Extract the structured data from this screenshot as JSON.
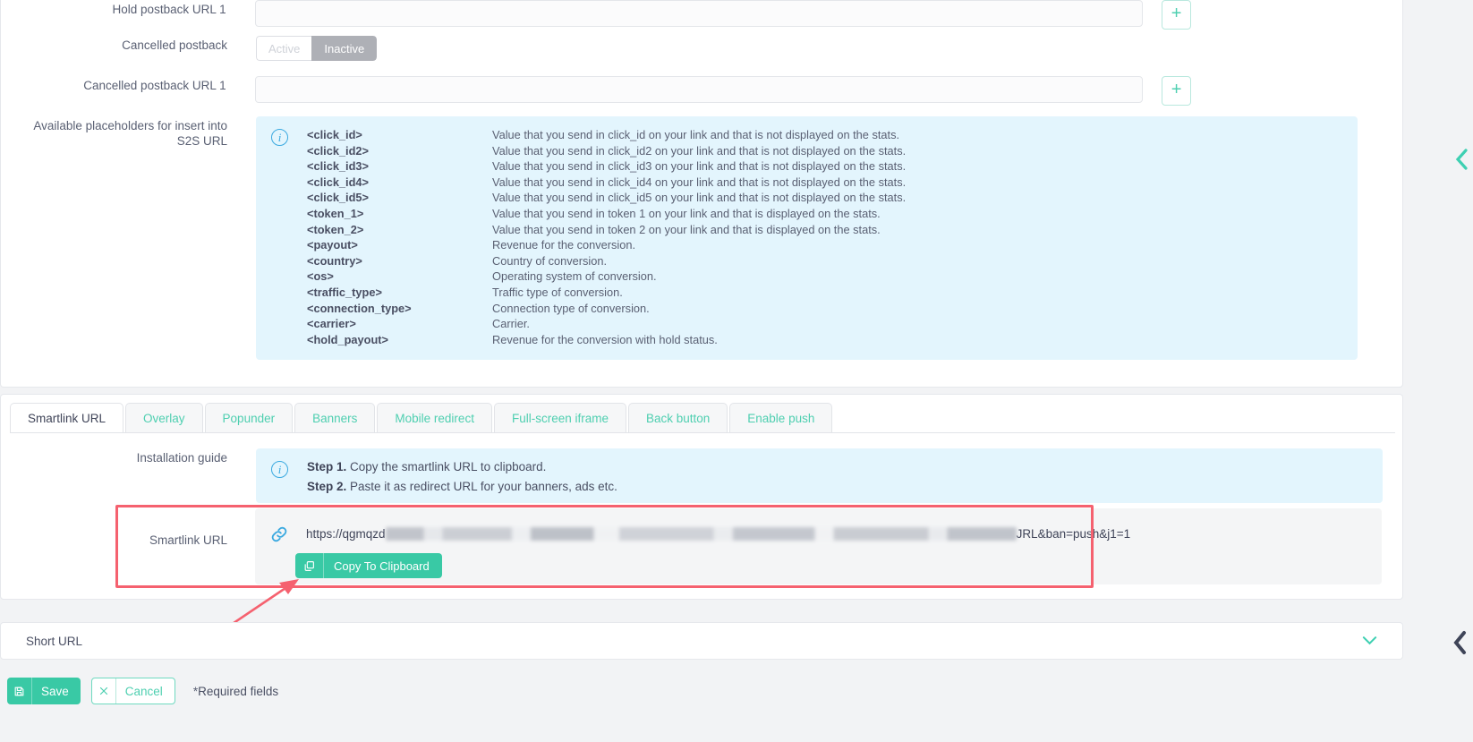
{
  "form": {
    "hold_postback_url_label": "Hold postback URL 1",
    "hold_postback_url_value": "",
    "cancelled_postback_label": "Cancelled postback",
    "cancelled_postback_toggle": {
      "inactive_option": "Active",
      "active_option": "Inactive"
    },
    "cancelled_postback_url_label": "Cancelled postback URL 1",
    "cancelled_postback_url_value": "",
    "add_button_label": "+",
    "placeholders_label_line1": "Available placeholders for insert into",
    "placeholders_label_line2": "S2S URL",
    "info_icon_glyph": "i"
  },
  "placeholders": [
    {
      "key": "<click_id>",
      "desc": "Value that you send in click_id on your link and that is not displayed on the stats."
    },
    {
      "key": "<click_id2>",
      "desc": "Value that you send in click_id2 on your link and that is not displayed on the stats."
    },
    {
      "key": "<click_id3>",
      "desc": "Value that you send in click_id3 on your link and that is not displayed on the stats."
    },
    {
      "key": "<click_id4>",
      "desc": "Value that you send in click_id4 on your link and that is not displayed on the stats."
    },
    {
      "key": "<click_id5>",
      "desc": "Value that you send in click_id5 on your link and that is not displayed on the stats."
    },
    {
      "key": "<token_1>",
      "desc": "Value that you send in token 1 on your link and that is displayed on the stats."
    },
    {
      "key": "<token_2>",
      "desc": "Value that you send in token 2 on your link and that is displayed on the stats."
    },
    {
      "key": "<payout>",
      "desc": "Revenue for the conversion."
    },
    {
      "key": "<country>",
      "desc": "Country of conversion."
    },
    {
      "key": "<os>",
      "desc": "Operating system of conversion."
    },
    {
      "key": "<traffic_type>",
      "desc": "Traffic type of conversion."
    },
    {
      "key": "<connection_type>",
      "desc": "Connection type of conversion."
    },
    {
      "key": "<carrier>",
      "desc": "Carrier."
    },
    {
      "key": "<hold_payout>",
      "desc": "Revenue for the conversion with hold status."
    }
  ],
  "tabs": [
    {
      "label": "Smartlink URL",
      "active": true
    },
    {
      "label": "Overlay",
      "active": false
    },
    {
      "label": "Popunder",
      "active": false
    },
    {
      "label": "Banners",
      "active": false
    },
    {
      "label": "Mobile redirect",
      "active": false
    },
    {
      "label": "Full-screen iframe",
      "active": false
    },
    {
      "label": "Back button",
      "active": false
    },
    {
      "label": "Enable push",
      "active": false
    }
  ],
  "installation_guide": {
    "label": "Installation guide",
    "step1_bold": "Step 1.",
    "step1_text": " Copy the smartlink URL to clipboard.",
    "step2_bold": "Step 2.",
    "step2_text": " Paste it as redirect URL for your banners, ads etc."
  },
  "smartlink": {
    "label": "Smartlink URL",
    "url_prefix": "https://qgmqzd",
    "url_suffix": "JRL&ban=push&j1=1",
    "copy_button_label": "Copy To Clipboard",
    "link_icon": "link-icon",
    "copy_icon": "copy-icon"
  },
  "short_url": {
    "label": "Short URL",
    "chevron_icon": "chevron-down-icon"
  },
  "footer": {
    "save_label": "Save",
    "cancel_label": "Cancel",
    "required_star": "*",
    "required_text": "Required fields",
    "save_icon": "floppy-disk-icon",
    "cancel_icon": "close-x-icon"
  },
  "side_handles": {
    "top_icon": "chevron-left-icon",
    "bottom_icon": "chevron-left-icon"
  },
  "colors": {
    "accent_teal": "#39c9a5",
    "info_blue_bg": "#e3f5fd",
    "info_blue_icon": "#3aa9e0",
    "highlight_red": "#f5616f",
    "toggle_active_gray": "#aeb0b6"
  }
}
